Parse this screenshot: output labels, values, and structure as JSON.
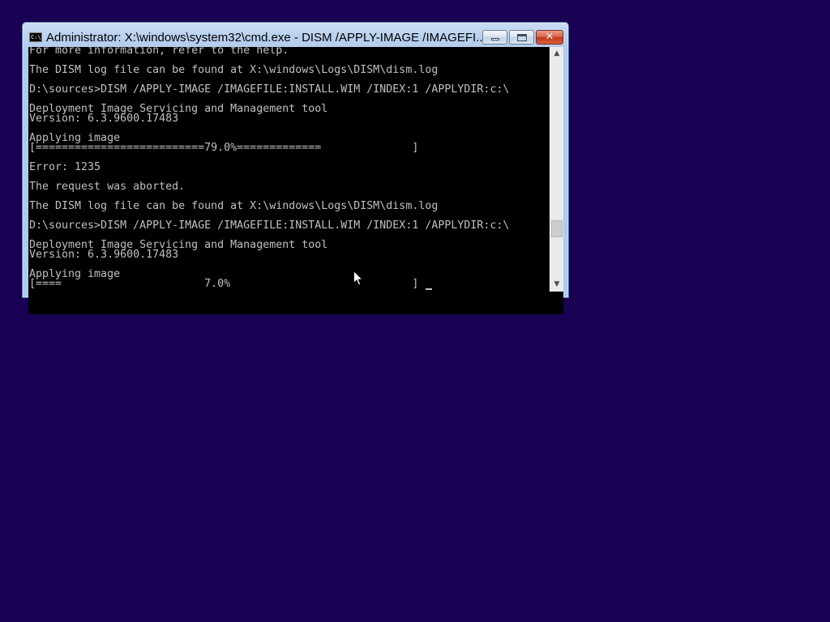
{
  "window": {
    "title": "Administrator: X:\\windows\\system32\\cmd.exe - DISM  /APPLY-IMAGE /IMAGEFI...",
    "icon_label": "C:\\",
    "minimize_icon": "minimize-icon",
    "maximize_icon": "maximize-icon",
    "close_icon": "close-icon",
    "close_label": "✕"
  },
  "console": {
    "lines": [
      "For more information, refer to the help.",
      "",
      "The DISM log file can be found at X:\\windows\\Logs\\DISM\\dism.log",
      "",
      "D:\\sources>DISM /APPLY-IMAGE /IMAGEFILE:INSTALL.WIM /INDEX:1 /APPLYDIR:c:\\",
      "",
      "Deployment Image Servicing and Management tool",
      "Version: 6.3.9600.17483",
      "",
      "Applying image",
      "[==========================79.0%=============              ]",
      "",
      "Error: 1235",
      "",
      "The request was aborted.",
      "",
      "The DISM log file can be found at X:\\windows\\Logs\\DISM\\dism.log",
      "",
      "D:\\sources>DISM /APPLY-IMAGE /IMAGEFILE:INSTALL.WIM /INDEX:1 /APPLYDIR:c:\\",
      "",
      "Deployment Image Servicing and Management tool",
      "Version: 6.3.9600.17483",
      "",
      "Applying image",
      "[====                      7.0%                            ]"
    ],
    "previous_progress_percent": 79.0,
    "current_progress_percent": 7.0,
    "error_code": "1235"
  },
  "scrollbar": {
    "up_arrow_icon": "chevron-up-icon",
    "down_arrow_icon": "chevron-down-icon",
    "up_glyph": "▲",
    "down_glyph": "▼"
  },
  "colors": {
    "desktop_background": "#180052",
    "console_background": "#000000",
    "console_text": "#c0c0c0",
    "close_button": "#c3371a"
  }
}
